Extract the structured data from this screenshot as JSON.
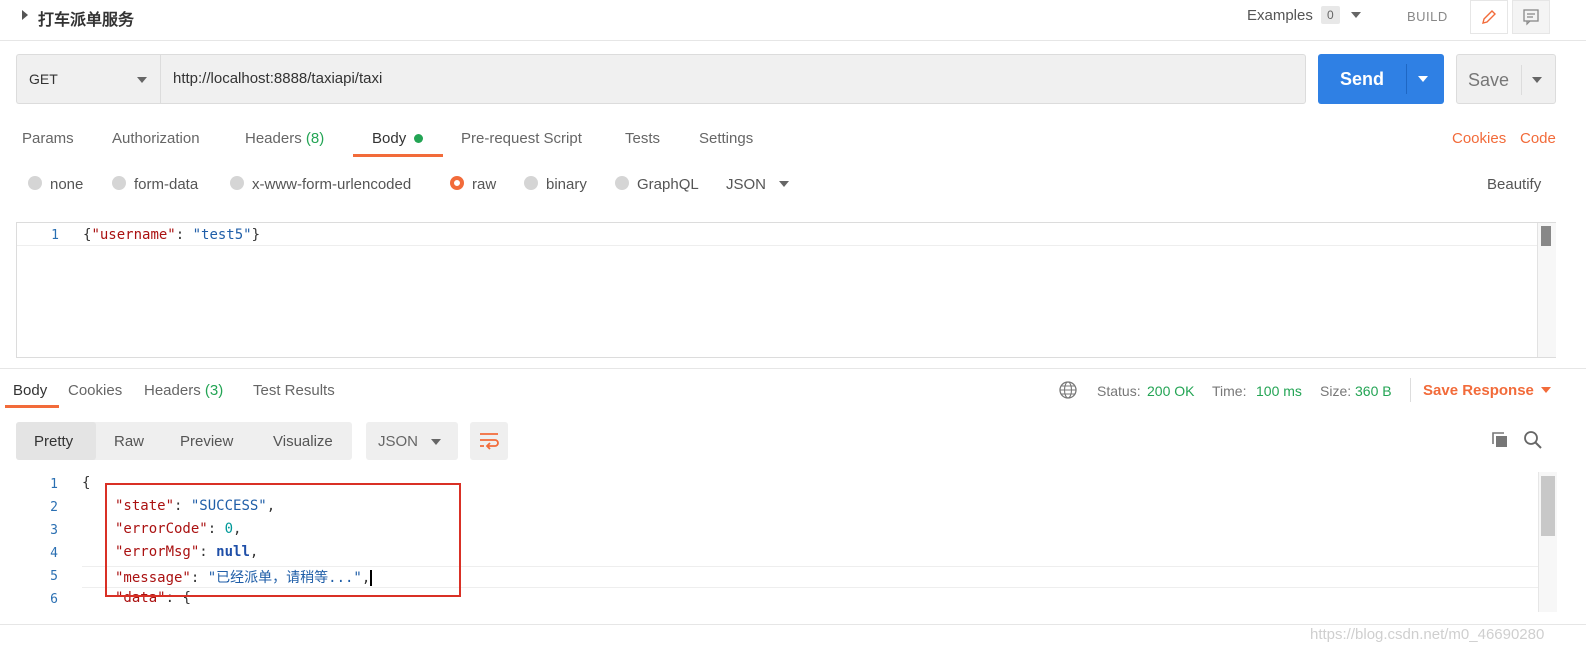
{
  "header": {
    "title": "打车派单服务",
    "examples_label": "Examples",
    "examples_count": "0",
    "build_label": "BUILD"
  },
  "request": {
    "method": "GET",
    "url": "http://localhost:8888/taxiapi/taxi",
    "send_label": "Send",
    "save_label": "Save"
  },
  "request_tabs": {
    "params": "Params",
    "authorization": "Authorization",
    "headers": "Headers",
    "headers_count": "(8)",
    "body": "Body",
    "pre_request": "Pre-request Script",
    "tests": "Tests",
    "settings": "Settings",
    "cookies": "Cookies",
    "code": "Code"
  },
  "body_types": {
    "none": "none",
    "form_data": "form-data",
    "urlencoded": "x-www-form-urlencoded",
    "raw": "raw",
    "binary": "binary",
    "graphql": "GraphQL",
    "format": "JSON",
    "beautify": "Beautify"
  },
  "request_body": {
    "line1_num": "1",
    "brace_open": "{",
    "key": "\"username\"",
    "colon": ": ",
    "value": "\"test5\"",
    "brace_close": "}"
  },
  "response_tabs": {
    "body": "Body",
    "cookies": "Cookies",
    "headers": "Headers",
    "headers_count": "(3)",
    "test_results": "Test Results"
  },
  "response_status": {
    "status_label": "Status:",
    "status_value": "200 OK",
    "time_label": "Time:",
    "time_value": "100 ms",
    "size_label": "Size:",
    "size_value": "360 B",
    "save_response": "Save Response"
  },
  "view_modes": {
    "pretty": "Pretty",
    "raw": "Raw",
    "preview": "Preview",
    "visualize": "Visualize",
    "format": "JSON"
  },
  "response_body": {
    "nums": [
      "1",
      "2",
      "3",
      "4",
      "5",
      "6"
    ],
    "brace_open": "{",
    "state_key": "\"state\"",
    "state_val": "\"SUCCESS\"",
    "errorCode_key": "\"errorCode\"",
    "errorCode_val": "0",
    "errorMsg_key": "\"errorMsg\"",
    "errorMsg_val": "null",
    "message_key": "\"message\"",
    "message_val": "\"已经派单，请稍等...\"",
    "data_key": "\"data\"",
    "data_open": "{",
    "colon": ": ",
    "comma": ","
  },
  "watermark": "https://blog.csdn.net/m0_46690280",
  "colors": {
    "accent": "#f26b3a",
    "send": "#2f80e4",
    "success": "#23a454",
    "highlight_box": "#d93025"
  }
}
